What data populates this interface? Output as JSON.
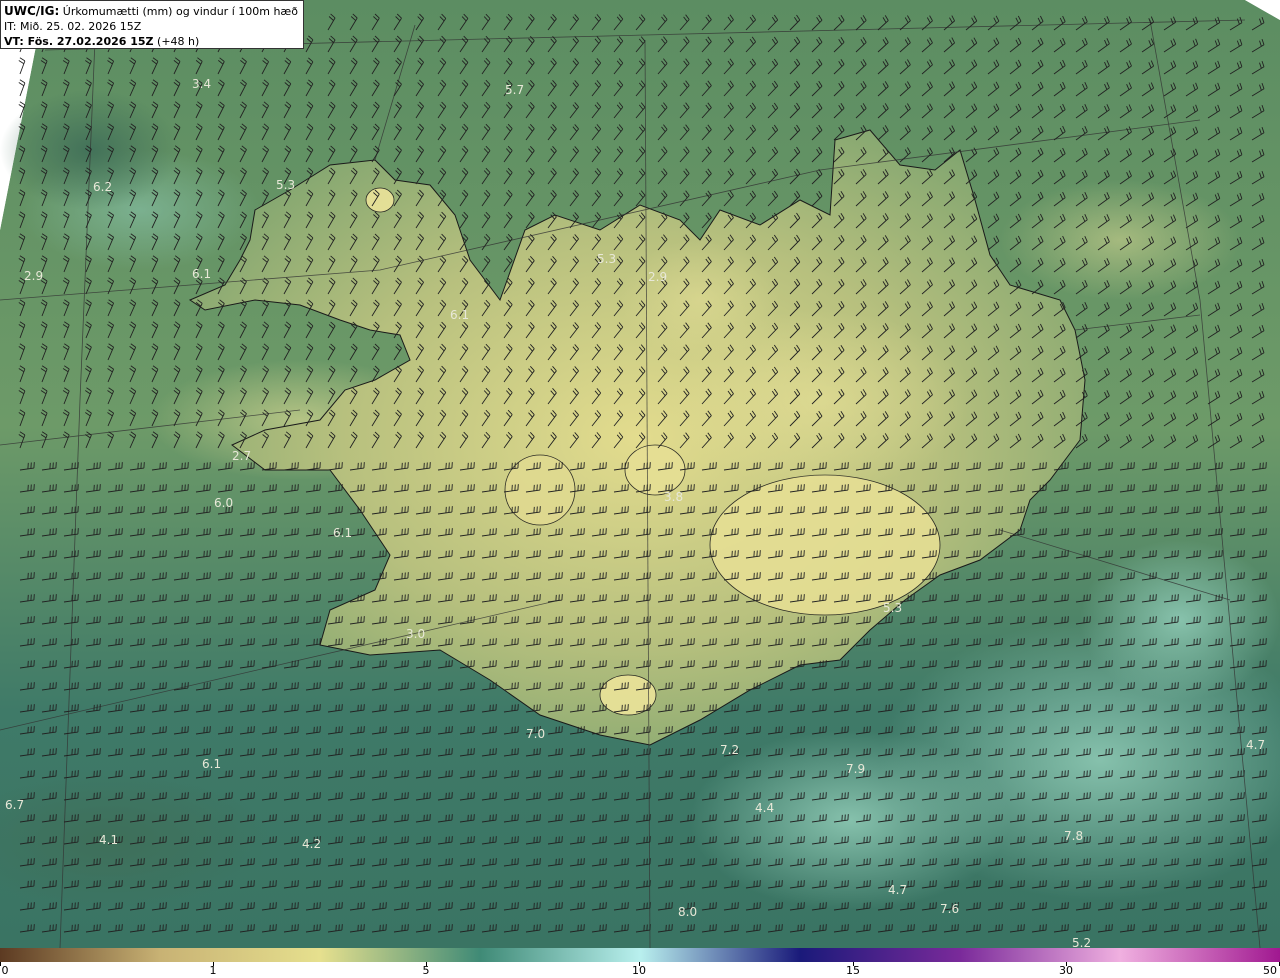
{
  "header": {
    "brand": "UWC/IG:",
    "title": "Úrkomumætti (mm) og vindur í 100m hæð",
    "init_time": "IT: Mið. 25. 02. 2026 15Z",
    "valid_prefix": "VT: Fös. 27.02.2026 15Z",
    "valid_suffix": " (+48 h)"
  },
  "colors": {
    "background_low": "#4d7a5f",
    "background_mid": "#6f9a6c",
    "land_bright": "#d6d68c",
    "sea_teal": "#5a9c86",
    "coastline": "#1a1a1a",
    "grid_line": "#333333",
    "barb": "#222222",
    "value_text": "#e8e8d8"
  },
  "map_labels": [
    {
      "text": "3.4"
    },
    {
      "text": "5.7"
    },
    {
      "text": "6.2"
    },
    {
      "text": "5.3"
    },
    {
      "text": "2.9"
    },
    {
      "text": "6.1"
    },
    {
      "text": "5.3"
    },
    {
      "text": "2.9"
    },
    {
      "text": "6.1"
    },
    {
      "text": "2.7"
    },
    {
      "text": "6.0"
    },
    {
      "text": "6.1"
    },
    {
      "text": "3.8"
    },
    {
      "text": "3.0"
    },
    {
      "text": "5.3"
    },
    {
      "text": "7.0"
    },
    {
      "text": "7.2"
    },
    {
      "text": "7.9"
    },
    {
      "text": "6.1"
    },
    {
      "text": "6.7"
    },
    {
      "text": "4.4"
    },
    {
      "text": "4.1"
    },
    {
      "text": "4.2"
    },
    {
      "text": "7.8"
    },
    {
      "text": "4.7"
    },
    {
      "text": "4.7"
    },
    {
      "text": "8.0"
    },
    {
      "text": "7.6"
    },
    {
      "text": "5.2"
    }
  ],
  "colorbar": {
    "ticks": [
      "0",
      "1",
      "5",
      "10",
      "15",
      "30",
      "50"
    ],
    "stops": [
      "#5c3a22",
      "#c8b274",
      "#e6e08e",
      "#3f8a76",
      "#b9f0ee",
      "#1a1a7a",
      "#7a2a9a",
      "#f0b0e0",
      "#a01890"
    ]
  }
}
